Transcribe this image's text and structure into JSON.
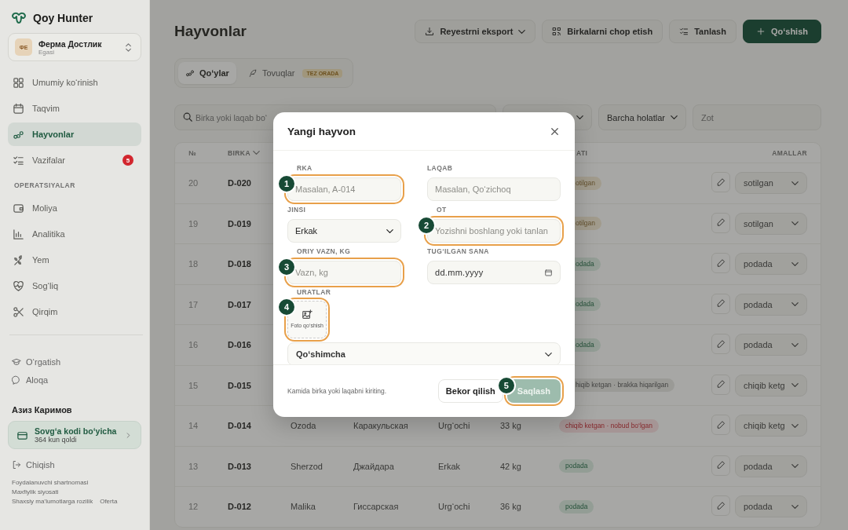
{
  "sidebar": {
    "brand": "Qoy Hunter",
    "farm": {
      "initials": "ФЕ",
      "name": "Ферма Достлик",
      "role": "Egasi"
    },
    "nav": [
      {
        "label": "Umumiy ko‘rinish",
        "selected": false
      },
      {
        "label": "Taqvim",
        "selected": false
      },
      {
        "label": "Hayvonlar",
        "selected": true
      },
      {
        "label": "Vazifalar",
        "selected": false,
        "badge": "5"
      }
    ],
    "section_label": "OPERATSIYALAR",
    "operations": [
      {
        "label": "Moliya",
        "selected": false
      },
      {
        "label": "Analitika",
        "selected": false
      },
      {
        "label": "Yem",
        "selected": false
      },
      {
        "label": "Sog‘liq",
        "selected": false
      },
      {
        "label": "Qirqim",
        "selected": false
      }
    ],
    "help": [
      {
        "label": "O‘rgatish"
      },
      {
        "label": "Aloqa"
      }
    ],
    "user_name": "Азиз Каримов",
    "plan": {
      "title": "Sovg‘a kodi bo‘yicha",
      "subtitle": "364 kun qoldi"
    },
    "logout": "Chiqish",
    "links": [
      "Foydalanuvchi shartnomasi",
      "Maxfiylik siyosati",
      "Shaxsiy ma’lumotlarga rozilik",
      "Oferta"
    ]
  },
  "page": {
    "title": "Hayvonlar",
    "actions": [
      {
        "label": "Reyestrni eksport",
        "kind": "secondary",
        "dropdown": true
      },
      {
        "label": "Birkalarni chop etish",
        "kind": "secondary",
        "dropdown": false
      },
      {
        "label": "Tanlash",
        "kind": "secondary",
        "dropdown": false
      },
      {
        "label": "Qo‘shish",
        "kind": "primary",
        "dropdown": false
      }
    ],
    "tabs": [
      {
        "label": "Qo‘ylar",
        "selected": true
      },
      {
        "label": "Tovuqlar",
        "selected": false,
        "badge": "TEZ ORADA"
      }
    ],
    "filters": {
      "search_placeholder": "Birka yoki laqab bo‘",
      "status": "Barcha holatlar",
      "breed_placeholder": "Zot"
    }
  },
  "table": {
    "columns": [
      "№",
      "BIRKA",
      "ATI",
      "AMALLAR"
    ],
    "rows": [
      {
        "num": "20",
        "tag": "D-020",
        "status": "otilgan",
        "kind": "sold",
        "action": "sotilgan"
      },
      {
        "num": "19",
        "tag": "D-019",
        "status": "otilgan",
        "kind": "sold",
        "action": "sotilgan"
      },
      {
        "num": "18",
        "tag": "D-018",
        "status": "odada",
        "kind": "herd",
        "action": "podada"
      },
      {
        "num": "17",
        "tag": "D-017",
        "status": "odada",
        "kind": "herd",
        "action": "podada"
      },
      {
        "num": "16",
        "tag": "D-016",
        "status": "odada",
        "kind": "herd",
        "action": "podada"
      },
      {
        "num": "15",
        "tag": "D-015",
        "status": "hiqib ketgan · brakka hiqarilgan",
        "kind": "culled",
        "action": "chiqib ketg"
      },
      {
        "num": "14",
        "tag": "D-014",
        "name": "Ozoda",
        "breed": "Каракульская",
        "sex": "Urg‘ochi",
        "weight": "33 kg",
        "status": "chiqib ketgan · nobud bo‘lgan",
        "kind": "dead",
        "action": "chiqib ketg"
      },
      {
        "num": "13",
        "tag": "D-013",
        "name": "Sherzod",
        "breed": "Джайдара",
        "sex": "Erkak",
        "weight": "42 kg",
        "status": "podada",
        "kind": "herd",
        "action": "podada"
      },
      {
        "num": "12",
        "tag": "D-012",
        "name": "Malika",
        "breed": "Гиссарская",
        "sex": "Urg‘ochi",
        "weight": "36 kg",
        "status": "podada",
        "kind": "herd",
        "action": "podada"
      }
    ]
  },
  "modal": {
    "title": "Yangi hayvon",
    "fields": [
      {
        "label": "RKA",
        "kind": "text",
        "placeholder": "Masalan, A-014",
        "step": "1"
      },
      {
        "label": "LAQAB",
        "kind": "text",
        "placeholder": "Masalan, Qo‘zichoq"
      },
      {
        "label": "JINSI",
        "kind": "select",
        "value": "Erkak"
      },
      {
        "label": "OT",
        "kind": "text",
        "placeholder": "Yozishni boshlang yoki tanlan",
        "step": "2"
      },
      {
        "label": "ORIY VAZN, KG",
        "kind": "text",
        "placeholder": "Vazn, kg",
        "step": "3"
      },
      {
        "label": "TUG‘ILGAN SANA",
        "kind": "date",
        "placeholder": "dd.mm.yyyy"
      }
    ],
    "photos": {
      "label": "URATLAR",
      "button": "Foto qo‘shish",
      "step": "4"
    },
    "more": {
      "label": "Qo‘shimcha",
      "expanded": false
    },
    "hint": "Kamida birka yoki laqabni kiriting.",
    "cancel": "Bekor qilish",
    "save": {
      "label": "Saqlash",
      "disabled": true,
      "step": "5"
    }
  }
}
